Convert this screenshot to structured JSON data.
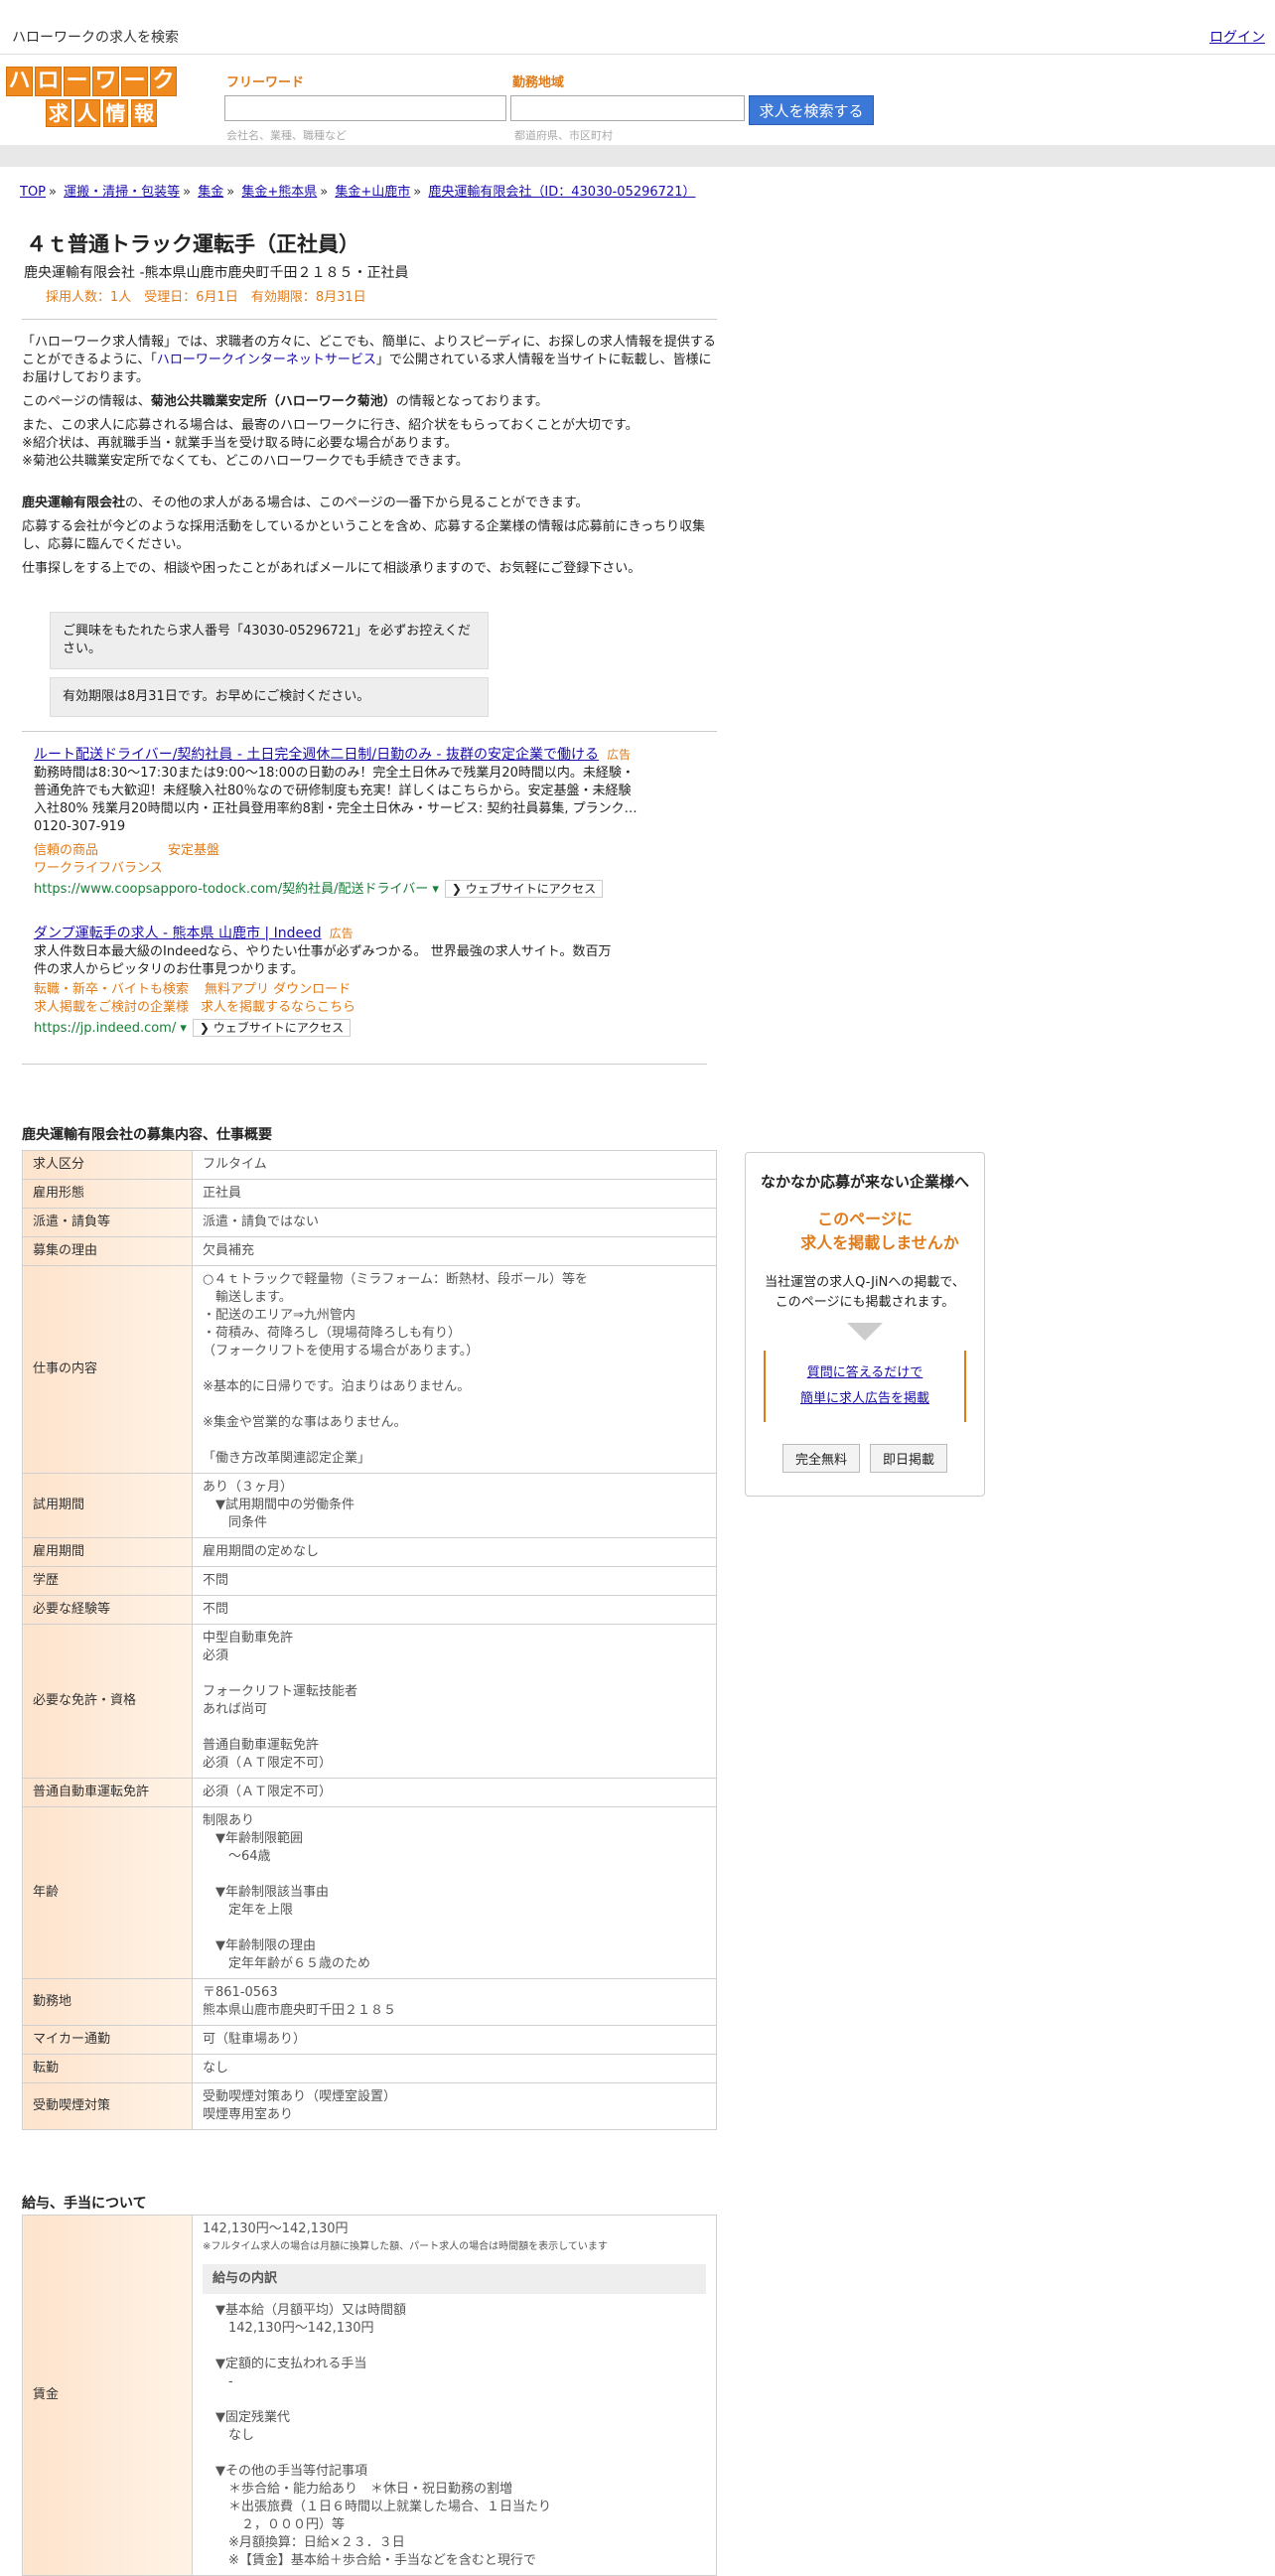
{
  "topbar": {
    "site_name": "ハローワークの求人を検索",
    "login": "ログイン"
  },
  "logo": {
    "row1": [
      "ハ",
      "ロ",
      "ー",
      "ワ",
      "ー",
      "ク"
    ],
    "row2": [
      "求",
      "人",
      "情",
      "報"
    ]
  },
  "search": {
    "keyword_label": "フリーワード",
    "keyword_placeholder": "会社名、業種、職種など",
    "area_label": "勤務地域",
    "area_placeholder": "都道府県、市区町村",
    "button": "求人を検索する"
  },
  "breadcrumbs": [
    "TOP",
    "運搬・清掃・包装等",
    "集金",
    "集金+熊本県",
    "集金+山鹿市",
    "鹿央運輸有限会社（ID：43030-05296721）"
  ],
  "job": {
    "title": "４ｔ普通トラック運転手（正社員）",
    "company_line": "鹿央運輸有限会社 -熊本県山鹿市鹿央町千田２１８５・正社員",
    "meta": "採用人数：1人　受理日：6月1日　有効期限：8月31日"
  },
  "intro": {
    "p1a": "「ハローワーク求人情報」では、求職者の方々に、どこでも、簡単に、よりスピーディに、お探しの求人情報を提供することができるように、「",
    "p1_link": "ハローワークインターネットサービス",
    "p1b": "」で公開されている求人情報を当サイトに転載し、皆様にお届けしております。",
    "p2a": "このページの情報は、",
    "p2_bold": "菊池公共職業安定所（ハローワーク菊池）",
    "p2b": "の情報となっております。",
    "p3": "また、この求人に応募される場合は、最寄のハローワークに行き、紹介状をもらっておくことが大切です。\n※紹介状は、再就職手当・就業手当を受け取る時に必要な場合があります。\n※菊池公共職業安定所でなくても、どこのハローワークでも手続きできます。",
    "p4_bold": "鹿央運輸有限会社",
    "p4": "の、その他の求人がある場合は、このページの一番下から見ることができます。",
    "p5": "応募する会社が今どのような採用活動をしているかということを含め、応募する企業様の情報は応募前にきっちり収集し、応募に臨んでください。",
    "p6": "仕事探しをする上での、相談や困ったことがあればメールにて相談承りますので、お気軽にご登録下さい。"
  },
  "notices": [
    "ご興味をもたれたら求人番号「43030-05296721」を必ずお控えください。",
    "有効期限は8月31日です。お早めにご検討ください。"
  ],
  "ads": [
    {
      "title": "ルート配送ドライバー/契約社員 - 土日完全週休二日制/日勤のみ - 抜群の安定企業で働ける",
      "badge": "広告",
      "desc": "勤務時間は8:30～17:30または9:00～18:00の日勤のみ！完全土日休みで残業月20時間以内。未経験・普通免許でも大歓迎！未経験入社80％なので研修制度も充実！詳しくはこちらから。安定基盤・未経験入社80% 残業月20時間以内・正社員登用率約8割・完全土日休み・サービス: 契約社員募集, プランク…",
      "phone": "0120-307-919",
      "links1": [
        "信頼の商品",
        "安定基盤"
      ],
      "links2": [
        "ワークライフバランス"
      ],
      "url": "https://www.coopsapporo-todock.com/契約社員/配送ドライバー ▾",
      "visit": "❯ ウェブサイトにアクセス"
    },
    {
      "title": "ダンプ運転手の求人 - 熊本県 山鹿市 | Indeed",
      "badge": "広告",
      "desc": "求人件数日本最大級のIndeedなら、やりたい仕事が必ずみつかる。 世界最強の求人サイト。数百万件の求人からピッタリのお仕事見つかります。",
      "links1": [
        "転職・新卒・バイトも検索",
        "無料アプリ ダウンロード"
      ],
      "links2": [
        "求人掲載をご検討の企業様",
        "求人を掲載するならこちら"
      ],
      "url": "https://jp.indeed.com/ ▾",
      "visit": "❯ ウェブサイトにアクセス"
    }
  ],
  "details": {
    "title": "鹿央運輸有限会社の募集内容、仕事概要",
    "rows": [
      {
        "k": "求人区分",
        "v": "フルタイム"
      },
      {
        "k": "雇用形態",
        "v": "正社員"
      },
      {
        "k": "派遣・請負等",
        "v": "派遣・請負ではない"
      },
      {
        "k": "募集の理由",
        "v": "欠員補充"
      },
      {
        "k": "仕事の内容",
        "v": "○４ｔトラックで軽量物（ミラフォーム：断熱材、段ボール）等を\n　輸送します。\n・配送のエリア⇒九州管内\n・荷積み、荷降ろし（現場荷降ろしも有り）\n（フォークリフトを使用する場合があります。）\n\n※基本的に日帰りです。泊まりはありません。\n\n※集金や営業的な事はありません。\n\n「働き方改革関連認定企業」"
      },
      {
        "k": "試用期間",
        "v": "あり（３ヶ月）\n　▼試用期間中の労働条件\n　　同条件"
      },
      {
        "k": "雇用期間",
        "v": "雇用期間の定めなし"
      },
      {
        "k": "学歴",
        "v": "不問"
      },
      {
        "k": "必要な経験等",
        "v": "不問"
      },
      {
        "k": "必要な免許・資格",
        "v": "中型自動車免許\n必須\n\nフォークリフト運転技能者\nあれば尚可\n\n普通自動車運転免許\n必須（ＡＴ限定不可）\n"
      },
      {
        "k": "普通自動車運転免許",
        "v": "必須（ＡＴ限定不可）"
      },
      {
        "k": "年齢",
        "v": "制限あり\n　▼年齢制限範囲\n　　〜64歳\n\n　▼年齢制限該当事由\n　　定年を上限\n\n　▼年齢制限の理由\n　　定年年齢が６５歳のため"
      },
      {
        "k": "勤務地",
        "v": "〒861-0563\n熊本県山鹿市鹿央町千田２１８５"
      },
      {
        "k": "マイカー通勤",
        "v": "可（駐車場あり）"
      },
      {
        "k": "転勤",
        "v": "なし"
      },
      {
        "k": "受動喫煙対策",
        "v": "受動喫煙対策あり（喫煙室設置）\n喫煙専用室あり"
      }
    ]
  },
  "sidebox": {
    "heading": "なかなか応募が来ない企業様へ",
    "orange1": "このページに",
    "orange2": "求人を掲載しませんか",
    "text": "当社運営の求人Q-JiNへの掲載で、\nこのページにも掲載されます。",
    "link1": "質問に答えるだけで",
    "link2": "簡単に求人広告を掲載",
    "btn1": "完全無料",
    "btn2": "即日掲載"
  },
  "salary": {
    "title": "給与、手当について",
    "key": "賃金",
    "range": "142,130円〜142,130円",
    "note": "※フルタイム求人の場合は月額に換算した額、パート求人の場合は時間額を表示しています",
    "breakdown_label": "給与の内訳",
    "breakdown": "　▼基本給（月額平均）又は時間額\n　　142,130円〜142,130円\n\n　▼定額的に支払われる手当\n　　-\n\n　▼固定残業代\n　　なし\n\n　▼その他の手当等付記事項\n　　＊歩合給・能力給あり　＊休日・祝日勤務の割増\n　　＊出張旅費（１日６時間以上就業した場合、１日当たり\n　　　２，０００円）等\n　　※月額換算：日給×２３．３日\n　　※【賃金】基本給＋歩合給・手当などを含むと現行で"
  }
}
